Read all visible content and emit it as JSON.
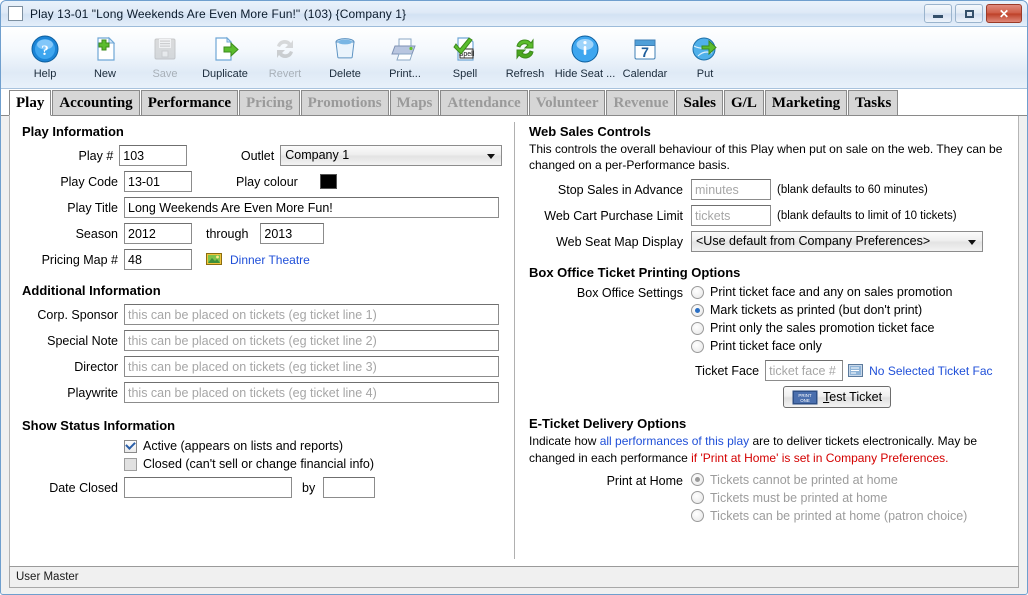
{
  "window": {
    "title": "Play 13-01 \"Long Weekends Are Even More Fun!\" (103) {Company 1}",
    "minimize_label": "Minimize",
    "maximize_label": "Maximize",
    "close_label": "✕"
  },
  "toolbar": [
    {
      "label": "Help",
      "icon": "help-icon",
      "enabled": true
    },
    {
      "label": "New",
      "icon": "new-page-icon",
      "enabled": true
    },
    {
      "label": "Save",
      "icon": "save-disk-icon",
      "enabled": false
    },
    {
      "label": "Duplicate",
      "icon": "duplicate-icon",
      "enabled": true
    },
    {
      "label": "Revert",
      "icon": "revert-icon",
      "enabled": false
    },
    {
      "label": "Delete",
      "icon": "delete-trash-icon",
      "enabled": true
    },
    {
      "label": "Print...",
      "icon": "printer-icon",
      "enabled": true
    },
    {
      "label": "Spell",
      "icon": "spell-check-icon",
      "enabled": true
    },
    {
      "label": "Refresh",
      "icon": "refresh-icon",
      "enabled": true
    },
    {
      "label": "Hide Seat ...",
      "icon": "info-icon",
      "enabled": true
    },
    {
      "label": "Calendar",
      "icon": "calendar-icon",
      "enabled": true
    },
    {
      "label": "Put",
      "icon": "globe-put-icon",
      "enabled": true
    }
  ],
  "tabs": [
    {
      "label": "Play",
      "state": "active"
    },
    {
      "label": "Accounting",
      "state": "enabled"
    },
    {
      "label": "Performance",
      "state": "enabled"
    },
    {
      "label": "Pricing",
      "state": "disabled"
    },
    {
      "label": "Promotions",
      "state": "disabled"
    },
    {
      "label": "Maps",
      "state": "disabled"
    },
    {
      "label": "Attendance",
      "state": "disabled"
    },
    {
      "label": "Volunteer",
      "state": "disabled"
    },
    {
      "label": "Revenue",
      "state": "disabled"
    },
    {
      "label": "Sales",
      "state": "enabled"
    },
    {
      "label": "G/L",
      "state": "enabled"
    },
    {
      "label": "Marketing",
      "state": "enabled"
    },
    {
      "label": "Tasks",
      "state": "enabled"
    }
  ],
  "play_information": {
    "heading": "Play Information",
    "play_number_label": "Play #",
    "play_number_value": "103",
    "outlet_label": "Outlet",
    "outlet_value": "Company 1",
    "play_code_label": "Play Code",
    "play_code_value": "13-01",
    "play_colour_label": "Play colour",
    "play_colour_value": "#000000",
    "play_title_label": "Play Title",
    "play_title_value": "Long Weekends Are Even More Fun!",
    "season_label": "Season",
    "season_from_value": "2012",
    "through_label": "through",
    "season_to_value": "2013",
    "pricing_map_label": "Pricing Map #",
    "pricing_map_value": "48",
    "pricing_map_link": "Dinner Theatre"
  },
  "additional_information": {
    "heading": "Additional Information",
    "rows": [
      {
        "label": "Corp. Sponsor",
        "value": "",
        "placeholder": "this can be placed on tickets (eg ticket line 1)"
      },
      {
        "label": "Special Note",
        "value": "",
        "placeholder": "this can be placed on tickets (eg ticket line 2)"
      },
      {
        "label": "Director",
        "value": "",
        "placeholder": "this can be placed on tickets (eg ticket line 3)"
      },
      {
        "label": "Playwrite",
        "value": "",
        "placeholder": "this can be placed on tickets (eg ticket line 4)"
      }
    ]
  },
  "show_status": {
    "heading": "Show Status Information",
    "active_label": "Active (appears on lists and reports)",
    "active_checked": true,
    "closed_label": "Closed (can't sell or change financial info)",
    "closed_checked": false,
    "date_closed_label": "Date Closed",
    "date_closed_value": "",
    "by_label": "by",
    "by_value": ""
  },
  "web_sales": {
    "heading": "Web Sales Controls",
    "description": "This controls the overall behaviour of this Play when put on sale on the web.  They can be changed on a per-Performance basis.",
    "stop_sales_label": "Stop Sales in Advance",
    "stop_sales_value": "",
    "stop_sales_placeholder": "minutes",
    "stop_sales_hint": "(blank defaults to 60 minutes)",
    "cart_limit_label": "Web Cart Purchase Limit",
    "cart_limit_value": "",
    "cart_limit_placeholder": "tickets",
    "cart_limit_hint": "(blank defaults to limit of 10 tickets)",
    "seat_map_label": "Web Seat Map Display",
    "seat_map_value": "<Use default from Company Preferences>"
  },
  "box_office": {
    "heading": "Box Office Ticket Printing Options",
    "settings_label": "Box Office Settings",
    "options": [
      {
        "label": "Print ticket face and any on sales promotion",
        "selected": false
      },
      {
        "label": "Mark tickets as printed (but don't print)",
        "selected": true
      },
      {
        "label": "Print only the sales promotion ticket face",
        "selected": false
      },
      {
        "label": "Print ticket face only",
        "selected": false
      }
    ],
    "ticket_face_label": "Ticket Face",
    "ticket_face_value": "",
    "ticket_face_placeholder": "ticket face #",
    "ticket_face_status": "No Selected Ticket Fac",
    "test_ticket_label": "Test Ticket",
    "test_ticket_accesskey": "T"
  },
  "eticket": {
    "heading": "E-Ticket Delivery Options",
    "desc_part1": "Indicate how ",
    "desc_blue": "all performances of this play",
    "desc_part2": " are to deliver tickets electronically.  May be changed in each performance ",
    "desc_red": "if 'Print at Home' is set in Company Preferences.",
    "print_at_home_label": "Print at Home",
    "options": [
      {
        "label": "Tickets cannot be printed at home",
        "selected": true
      },
      {
        "label": "Tickets must be printed at home",
        "selected": false
      },
      {
        "label": "Tickets can be printed at home (patron choice)",
        "selected": false
      }
    ]
  },
  "statusbar": {
    "text": "User Master"
  }
}
